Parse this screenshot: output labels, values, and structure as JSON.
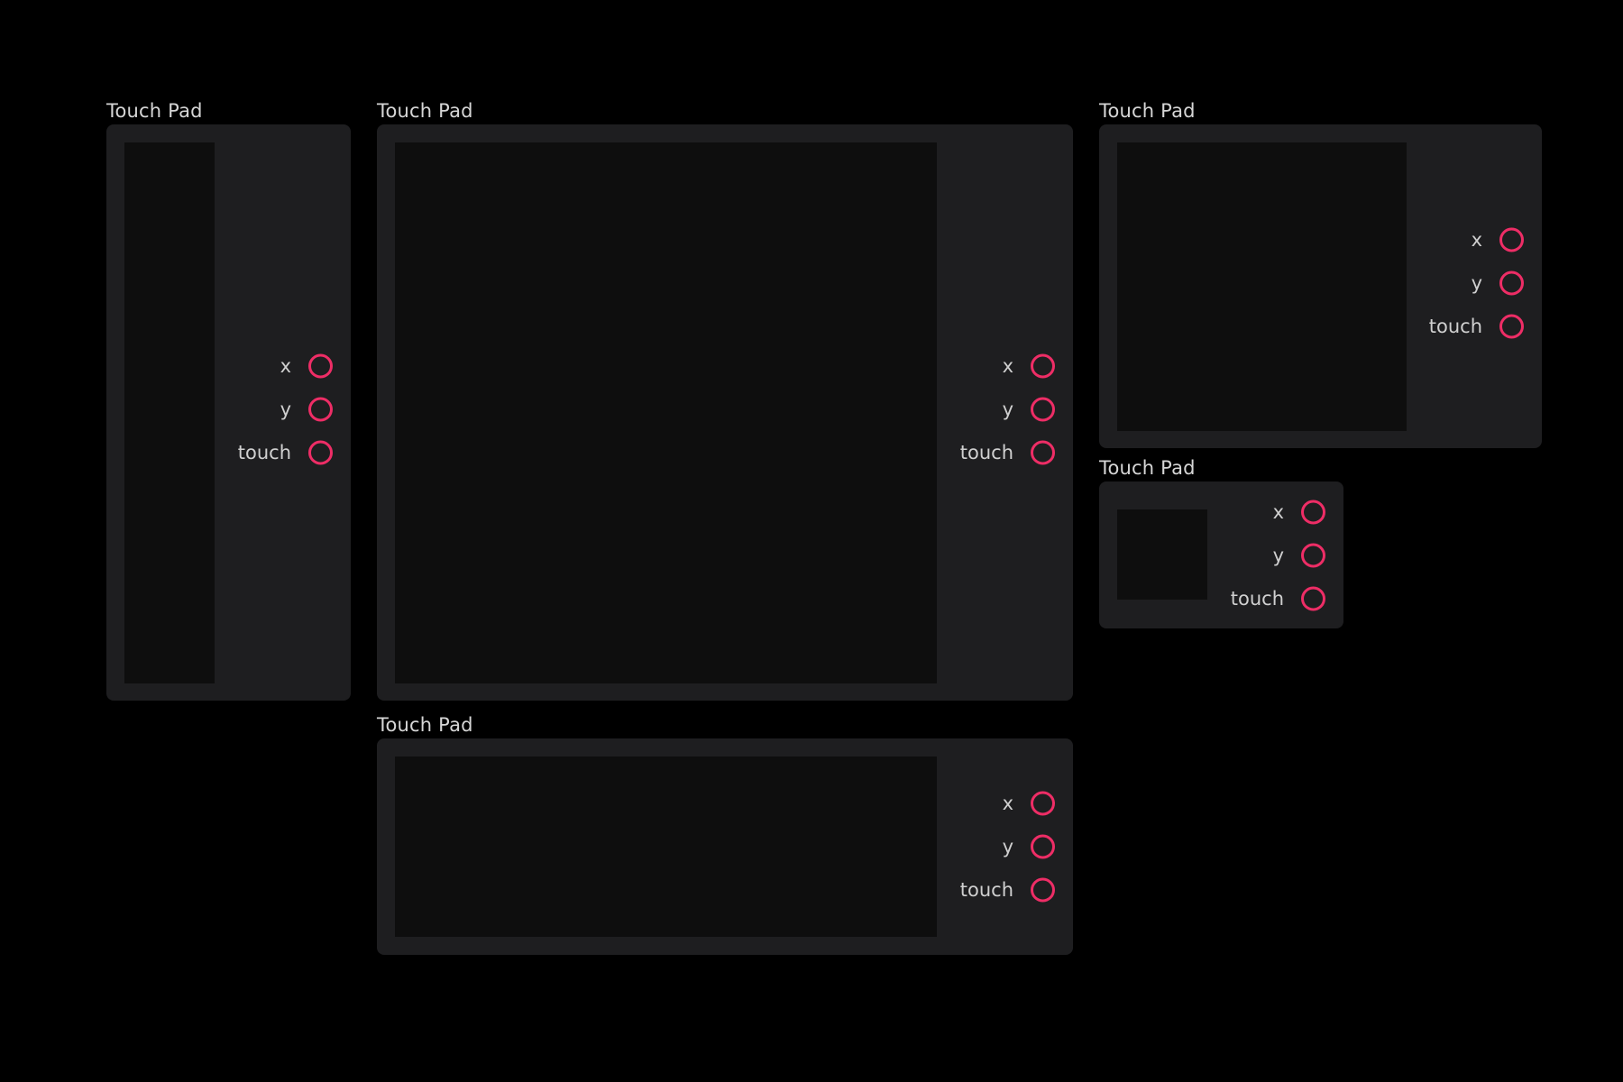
{
  "modules": [
    {
      "id": "pad-1",
      "title": "Touch Pad",
      "outputs": [
        {
          "label": "x",
          "port_icon": "output-port-icon"
        },
        {
          "label": "y",
          "port_icon": "output-port-icon"
        },
        {
          "label": "touch",
          "port_icon": "output-port-icon"
        }
      ]
    },
    {
      "id": "pad-2",
      "title": "Touch Pad",
      "outputs": [
        {
          "label": "x",
          "port_icon": "output-port-icon"
        },
        {
          "label": "y",
          "port_icon": "output-port-icon"
        },
        {
          "label": "touch",
          "port_icon": "output-port-icon"
        }
      ]
    },
    {
      "id": "pad-3",
      "title": "Touch Pad",
      "outputs": [
        {
          "label": "x",
          "port_icon": "output-port-icon"
        },
        {
          "label": "y",
          "port_icon": "output-port-icon"
        },
        {
          "label": "touch",
          "port_icon": "output-port-icon"
        }
      ]
    },
    {
      "id": "pad-4",
      "title": "Touch Pad",
      "outputs": [
        {
          "label": "x",
          "port_icon": "output-port-icon"
        },
        {
          "label": "y",
          "port_icon": "output-port-icon"
        },
        {
          "label": "touch",
          "port_icon": "output-port-icon"
        }
      ]
    },
    {
      "id": "pad-5",
      "title": "Touch Pad",
      "outputs": [
        {
          "label": "x",
          "port_icon": "output-port-icon"
        },
        {
          "label": "y",
          "port_icon": "output-port-icon"
        },
        {
          "label": "touch",
          "port_icon": "output-port-icon"
        }
      ]
    }
  ],
  "colors": {
    "background": "#000000",
    "panel": "#1e1e20",
    "pad_surface": "#0e0e0e",
    "port_accent": "#ee2d66",
    "text": "#d6d6d6"
  }
}
